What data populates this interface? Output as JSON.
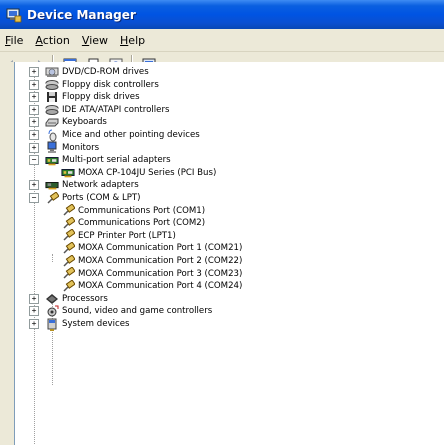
{
  "window": {
    "title": "Device Manager"
  },
  "menu": [
    {
      "label": "File",
      "mnemonic": "F"
    },
    {
      "label": "Action",
      "mnemonic": "A"
    },
    {
      "label": "View",
      "mnemonic": "V"
    },
    {
      "label": "Help",
      "mnemonic": "H"
    }
  ],
  "toolbar": {
    "buttons": [
      "back-icon",
      "forward-icon",
      "properties-icon",
      "print-icon",
      "help-icon",
      "scan-hardware-icon"
    ]
  },
  "tree": {
    "categories": [
      {
        "label": "DVD/CD-ROM drives",
        "expanded": false,
        "icon": "dvd-drive-icon"
      },
      {
        "label": "Floppy disk controllers",
        "expanded": false,
        "icon": "controller-icon"
      },
      {
        "label": "Floppy disk drives",
        "expanded": false,
        "icon": "floppy-icon"
      },
      {
        "label": "IDE ATA/ATAPI controllers",
        "expanded": false,
        "icon": "controller-icon"
      },
      {
        "label": "Keyboards",
        "expanded": false,
        "icon": "keyboard-icon"
      },
      {
        "label": "Mice and other pointing devices",
        "expanded": false,
        "icon": "mouse-icon"
      },
      {
        "label": "Monitors",
        "expanded": false,
        "icon": "monitor-icon"
      },
      {
        "label": "Multi-port serial adapters",
        "expanded": true,
        "icon": "serial-adapter-icon",
        "children": [
          {
            "label": "MOXA CP-104JU Series (PCI Bus)",
            "icon": "serial-adapter-icon"
          }
        ]
      },
      {
        "label": "Network adapters",
        "expanded": false,
        "icon": "network-icon"
      },
      {
        "label": "Ports (COM & LPT)",
        "expanded": true,
        "icon": "port-icon",
        "children": [
          {
            "label": "Communications Port (COM1)",
            "icon": "port-icon"
          },
          {
            "label": "Communications Port (COM2)",
            "icon": "port-icon"
          },
          {
            "label": "ECP Printer Port (LPT1)",
            "icon": "port-icon"
          },
          {
            "label": "MOXA Communication Port 1 (COM21)",
            "icon": "port-icon"
          },
          {
            "label": "MOXA Communication Port 2 (COM22)",
            "icon": "port-icon"
          },
          {
            "label": "MOXA Communication Port 3 (COM23)",
            "icon": "port-icon"
          },
          {
            "label": "MOXA Communication Port 4 (COM24)",
            "icon": "port-icon"
          }
        ]
      },
      {
        "label": "Processors",
        "expanded": false,
        "icon": "processor-icon"
      },
      {
        "label": "Sound, video and game controllers",
        "expanded": false,
        "icon": "sound-icon"
      },
      {
        "label": "System devices",
        "expanded": false,
        "icon": "system-icon"
      }
    ]
  }
}
